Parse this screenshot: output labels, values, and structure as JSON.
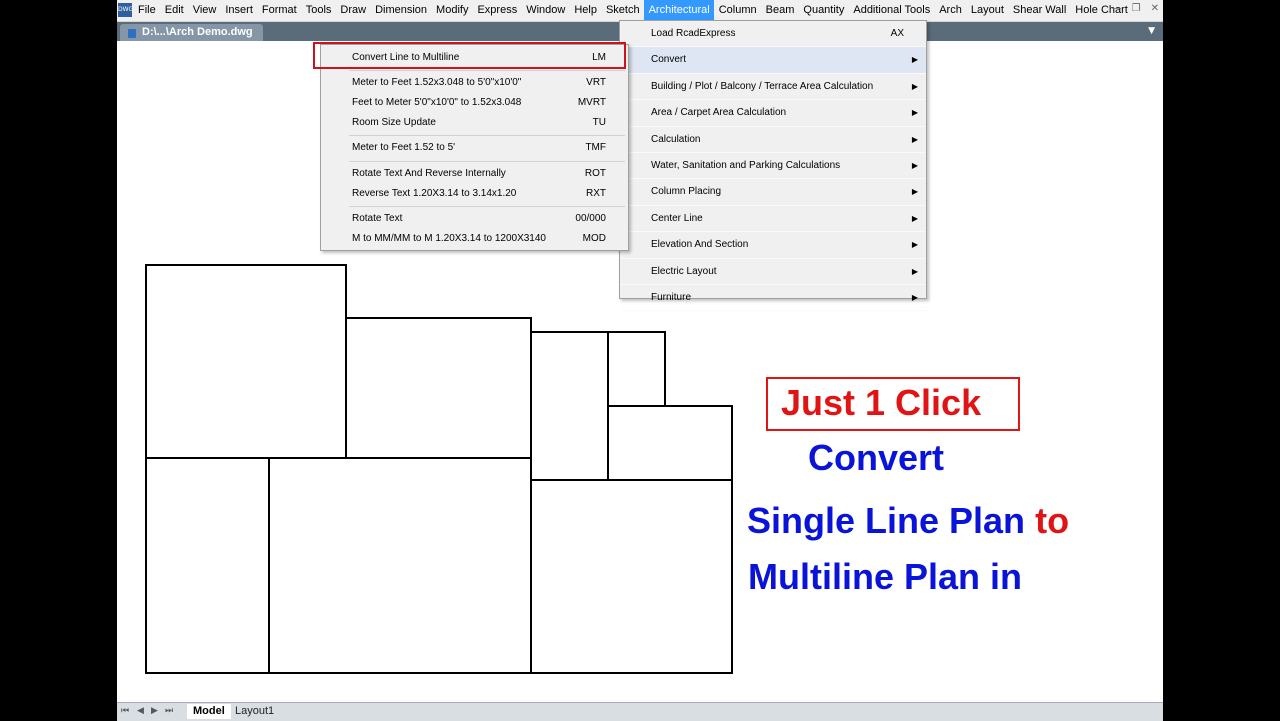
{
  "app_icon_text": "DWG",
  "menubar": {
    "items": [
      "File",
      "Edit",
      "View",
      "Insert",
      "Format",
      "Tools",
      "Draw",
      "Dimension",
      "Modify",
      "Express",
      "Window",
      "Help",
      "Sketch",
      "Architectural",
      "Column",
      "Beam",
      "Quantity",
      "Additional Tools",
      "Arch",
      "Layout",
      "Shear Wall",
      "Hole Chart"
    ],
    "active": "Architectural",
    "window_controls": [
      "—",
      "❐",
      "✕"
    ]
  },
  "tab": {
    "title": "D:\\...\\Arch Demo.dwg"
  },
  "architectural_menu": [
    {
      "label": "Load RcadExpress",
      "shortcut": "AX",
      "submenu": false
    },
    {
      "label": "Convert",
      "shortcut": "",
      "submenu": true
    },
    {
      "label": "Building / Plot / Balcony / Terrace Area Calculation",
      "shortcut": "",
      "submenu": true
    },
    {
      "label": "Area / Carpet Area Calculation",
      "shortcut": "",
      "submenu": true
    },
    {
      "label": "Calculation",
      "shortcut": "",
      "submenu": true
    },
    {
      "label": "Water, Sanitation and Parking Calculations",
      "shortcut": "",
      "submenu": true
    },
    {
      "label": "Column Placing",
      "shortcut": "",
      "submenu": true
    },
    {
      "label": "Center Line",
      "shortcut": "",
      "submenu": true
    },
    {
      "label": "Elevation And Section",
      "shortcut": "",
      "submenu": true
    },
    {
      "label": "Electric Layout",
      "shortcut": "",
      "submenu": true
    },
    {
      "label": "Furniture",
      "shortcut": "",
      "submenu": true
    }
  ],
  "convert_menu": [
    {
      "label": "Convert Line to Multiline",
      "shortcut": "LM"
    },
    {
      "label": "Meter to Feet 1.52x3.048 to 5'0\"x10'0\"",
      "shortcut": "VRT"
    },
    {
      "label": "Feet to Meter 5'0\"x10'0\" to 1.52x3.048",
      "shortcut": "MVRT"
    },
    {
      "label": "Room Size Update",
      "shortcut": "TU"
    },
    {
      "label": "Meter to Feet 1.52 to 5'",
      "shortcut": "TMF"
    },
    {
      "label": "Rotate Text And Reverse Internally",
      "shortcut": "ROT"
    },
    {
      "label": "Reverse Text 1.20X3.14 to 3.14x1.20",
      "shortcut": "RXT"
    },
    {
      "label": "Rotate Text",
      "shortcut": "00/000"
    },
    {
      "label": "M to MM/MM to M 1.20X3.14 to 1200X3140",
      "shortcut": "MOD"
    }
  ],
  "layout_tabs": {
    "model": "Model",
    "layout1": "Layout1"
  },
  "caption": {
    "line1": "Just 1 Click",
    "line2": "Convert",
    "line3a": "Single Line Plan",
    "line3b": "to",
    "line4": "Multiline Plan in"
  },
  "colors": {
    "caption_red": "#e01414",
    "caption_blue": "#0a14d8",
    "menu_highlight": "#3399ff",
    "outline_red": "#d0101a"
  }
}
